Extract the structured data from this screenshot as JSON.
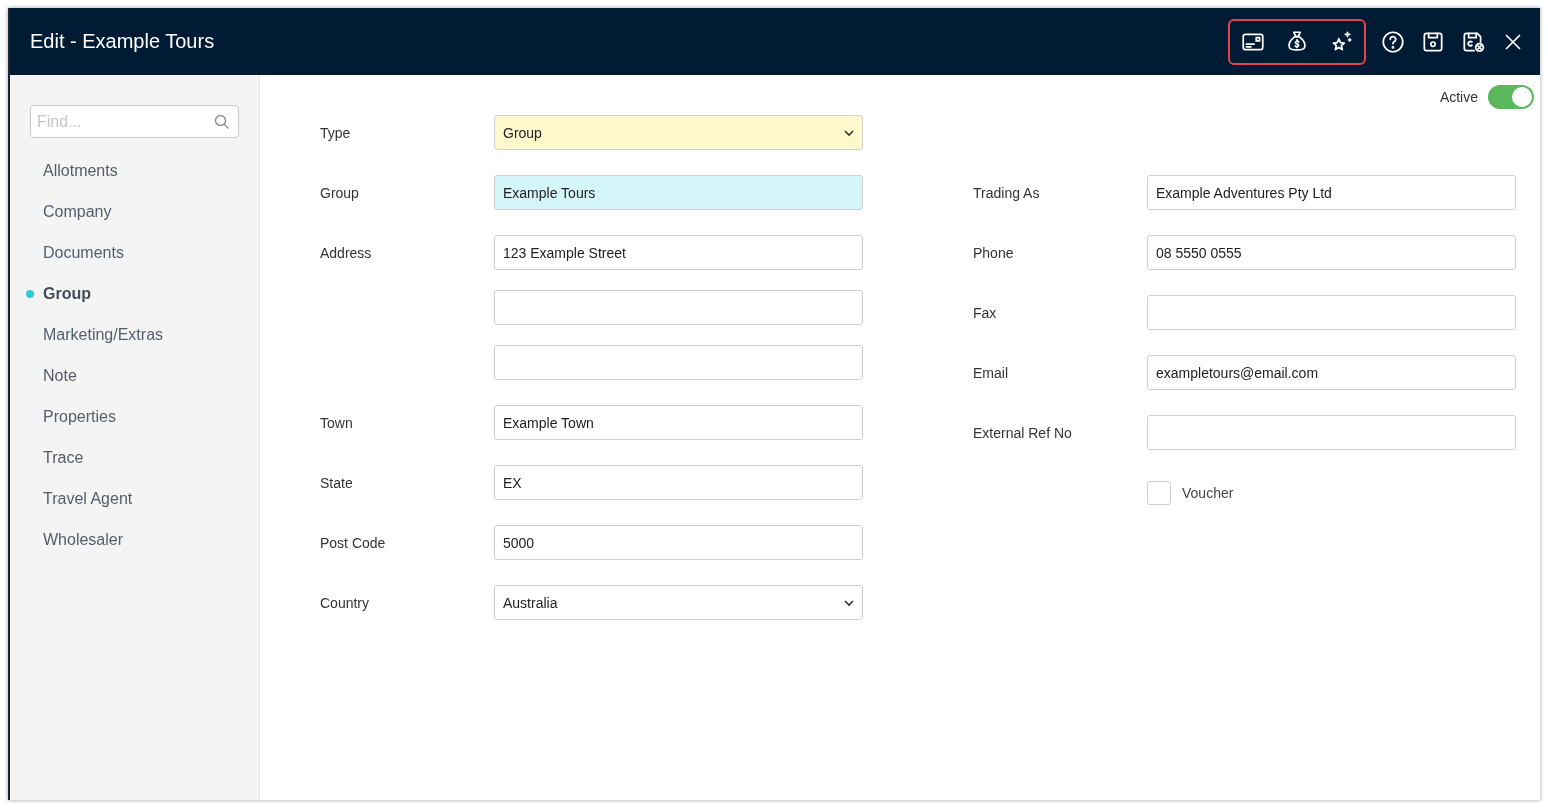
{
  "window": {
    "title": "Edit - Example Tours"
  },
  "sidebar": {
    "search": {
      "placeholder": "Find..."
    },
    "items": [
      {
        "label": "Allotments",
        "selected": false
      },
      {
        "label": "Company",
        "selected": false
      },
      {
        "label": "Documents",
        "selected": false
      },
      {
        "label": "Group",
        "selected": true
      },
      {
        "label": "Marketing/Extras",
        "selected": false
      },
      {
        "label": "Note",
        "selected": false
      },
      {
        "label": "Properties",
        "selected": false
      },
      {
        "label": "Trace",
        "selected": false
      },
      {
        "label": "Travel Agent",
        "selected": false
      },
      {
        "label": "Wholesaler",
        "selected": false
      }
    ]
  },
  "active": {
    "label": "Active",
    "on": true
  },
  "left_fields": [
    {
      "label": "Type",
      "kind": "select",
      "value": "Group",
      "color": "#fff8cc"
    },
    {
      "label": "Group",
      "kind": "text",
      "value": "Example Tours",
      "color": "#d4f5fa"
    },
    {
      "label": "Address",
      "kind": "text",
      "value": "123 Example Street"
    },
    {
      "kind": "text"
    },
    {
      "kind": "text"
    },
    {
      "label": "Town",
      "kind": "text",
      "value": "Example Town"
    },
    {
      "label": "State",
      "kind": "text",
      "value": "EX"
    },
    {
      "label": "Post Code",
      "kind": "text",
      "value": "5000"
    },
    {
      "label": "Country",
      "kind": "select",
      "value": "Australia"
    }
  ],
  "right_fields": [
    {
      "label": "Trading As",
      "kind": "text",
      "value": "Example Adventures Pty Ltd"
    },
    {
      "label": "Phone",
      "kind": "text",
      "value": "08 5550 0555"
    },
    {
      "label": "Fax",
      "kind": "text"
    },
    {
      "label": "Email",
      "kind": "text",
      "value": "exampletours@email.com"
    },
    {
      "label": "External Ref No",
      "kind": "text"
    },
    {
      "label": "Voucher",
      "kind": "checkbox",
      "checked": false
    }
  ]
}
